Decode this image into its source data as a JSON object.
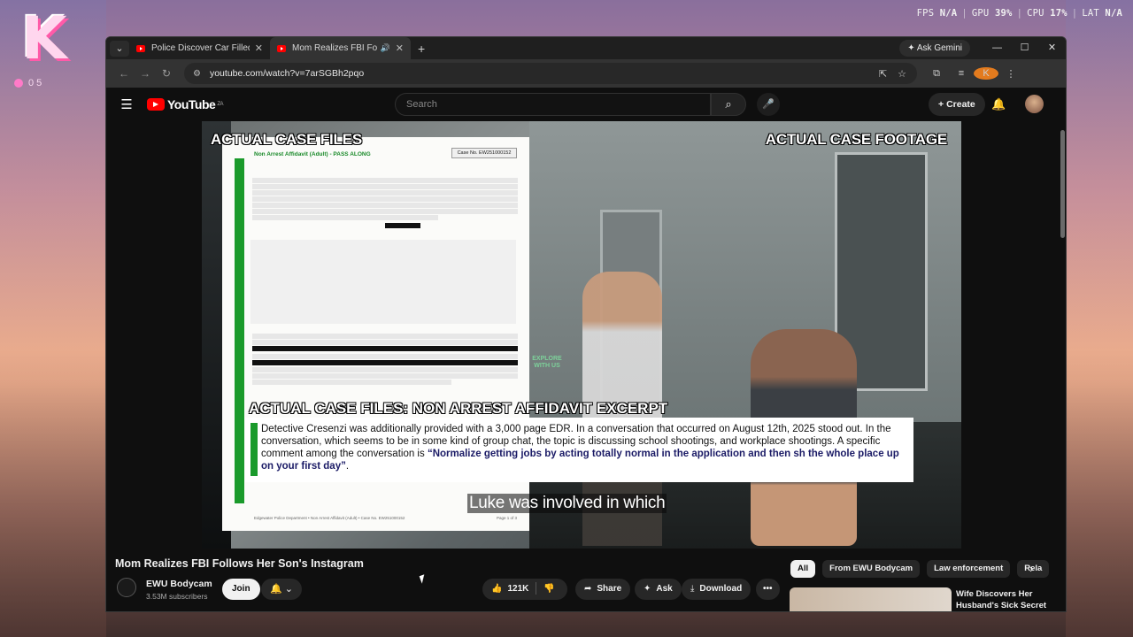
{
  "desktop": {
    "logo_letter": "K",
    "logo_meta": "0 5",
    "perf": {
      "fps_label": "FPS",
      "fps_value": "N/A",
      "gpu_label": "GPU",
      "gpu_value": "39%",
      "cpu_label": "CPU",
      "cpu_value": "17%",
      "lat_label": "LAT",
      "lat_value": "N/A"
    }
  },
  "browser": {
    "tabs": [
      {
        "title": "Police Discover Car Filled With",
        "icon": "youtube-icon"
      },
      {
        "title": "Mom Realizes FBI Follows H",
        "icon": "youtube-icon",
        "audio": "speaker-icon"
      }
    ],
    "gemini_label": "Ask Gemini",
    "url": "youtube.com/watch?v=7arSGBh2pqo",
    "profile_initial": "K"
  },
  "youtube": {
    "logo_text": "YouTube",
    "region": "ZA",
    "search_placeholder": "Search",
    "create_label": "Create"
  },
  "video": {
    "label_left": "ACTUAL CASE FILES",
    "label_right": "ACTUAL CASE FOOTAGE",
    "doc": {
      "case_no": "Case No. EW251000152",
      "title": "Non Arrest Affidavit (Adult) - PASS ALONG",
      "footer": "Edgewater Police Department • Non Arrest Affidavit (Adult) • Case No. EW251000152",
      "page": "Page 1 of 3"
    },
    "excerpt_label": "ACTUAL CASE FILES: NON ARREST AFFIDAVIT EXCERPT",
    "excerpt_text": "Detective Cresenzi was additionally provided with a 3,000 page EDR. In a conversation that occurred on August 12th, 2025 stood out. In the conversation, which seems to be in some kind of group chat, the topic is discussing school shootings, and workplace shootings. A specific comment among the conversation is ",
    "excerpt_quote": "“Normalize getting jobs by acting totally normal in the application and then sh the whole place up on your first day”",
    "excerpt_end": ".",
    "caption": "Luke was involved in which",
    "watermark": "EXPLORE WITH US"
  },
  "meta": {
    "title": "Mom Realizes FBI Follows Her Son's Instagram",
    "channel": "EWU Bodycam",
    "subscribers": "3.53M subscribers",
    "join_label": "Join",
    "likes": "121K",
    "share_label": "Share",
    "ask_label": "Ask",
    "download_label": "Download"
  },
  "sidebar": {
    "chips": [
      "All",
      "From EWU Bodycam",
      "Law enforcement",
      "Rela"
    ],
    "recommendation_title": "Wife Discovers Her Husband's Sick Secret"
  }
}
